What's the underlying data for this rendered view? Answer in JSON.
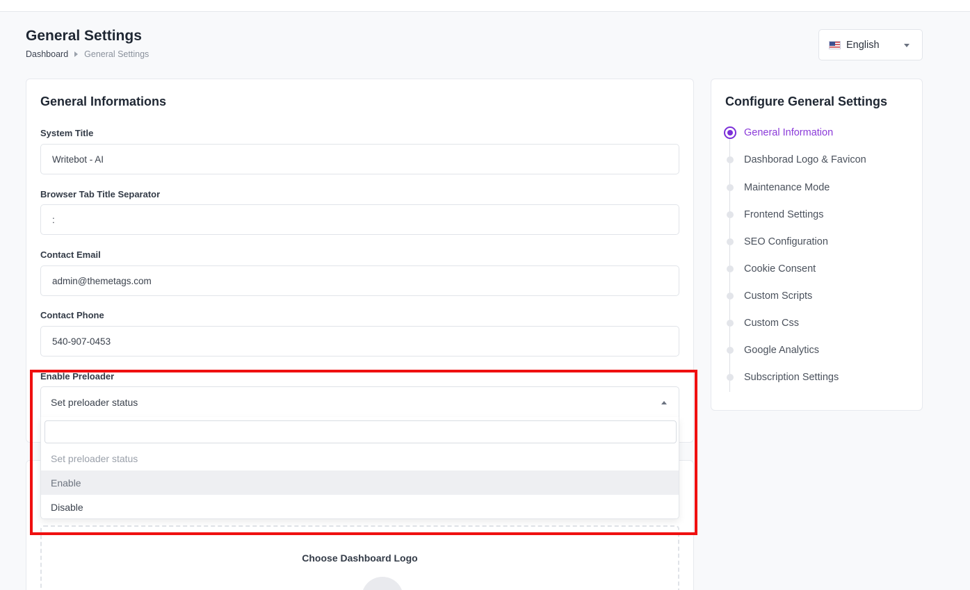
{
  "header": {
    "title": "General Settings",
    "breadcrumb": [
      "Dashboard",
      "General Settings"
    ]
  },
  "language": {
    "selected": "English",
    "flag_icon": "us-flag-icon"
  },
  "general_info": {
    "title": "General Informations",
    "fields": [
      {
        "label": "System Title",
        "value": "Writebot - AI"
      },
      {
        "label": "Browser Tab Title Separator",
        "value": ":"
      },
      {
        "label": "Contact Email",
        "value": "admin@themetags.com"
      },
      {
        "label": "Contact Phone",
        "value": "540-907-0453"
      }
    ],
    "preloader": {
      "label": "Enable Preloader",
      "selected": "Set preloader status",
      "search_value": "",
      "options": [
        "Set preloader status",
        "Enable",
        "Disable"
      ],
      "hovered_option": "Enable"
    }
  },
  "logo_section": {
    "dropzone_title": "Choose Dashboard Logo"
  },
  "sidebar": {
    "title": "Configure General Settings",
    "active_index": 0,
    "items": [
      {
        "label": "General Information"
      },
      {
        "label": "Dashborad Logo & Favicon"
      },
      {
        "label": "Maintenance Mode"
      },
      {
        "label": "Frontend Settings"
      },
      {
        "label": "SEO Configuration"
      },
      {
        "label": "Cookie Consent"
      },
      {
        "label": "Custom Scripts"
      },
      {
        "label": "Custom Css"
      },
      {
        "label": "Google Analytics"
      },
      {
        "label": "Subscription Settings"
      }
    ]
  },
  "colors": {
    "accent": "#7b2fd8",
    "highlight": "#ef1010"
  }
}
